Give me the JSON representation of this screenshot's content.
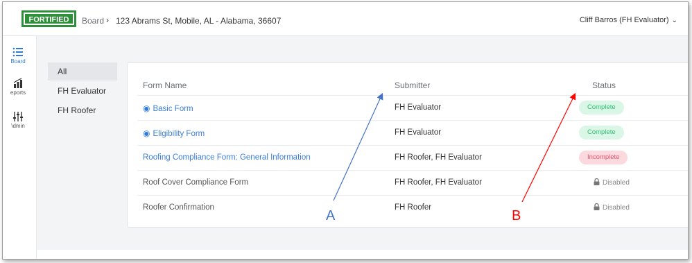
{
  "header": {
    "logo_text": "FORTIFIED",
    "breadcrumb_board": "Board",
    "breadcrumb_separator": "›",
    "breadcrumb_address": "123 Abrams St, Mobile, AL - Alabama, 36607",
    "user": "Cliff Barros (FH Evaluator)",
    "brand_green": "#2e8f3a"
  },
  "rail": {
    "items": [
      {
        "label": "Board",
        "icon": "list-icon",
        "active": true
      },
      {
        "label": "eports",
        "icon": "bar-chart-icon",
        "active": false
      },
      {
        "label": "\\dmin",
        "icon": "sliders-icon",
        "active": false
      }
    ]
  },
  "filters": [
    "All",
    "FH Evaluator",
    "FH Roofer"
  ],
  "table": {
    "headers": [
      "Form Name",
      "Submitter",
      "Status"
    ],
    "rows": [
      {
        "name": "Basic Form",
        "submitter": "FH Evaluator",
        "status": "Complete"
      },
      {
        "name": "Eligibility Form",
        "submitter": "FH Evaluator",
        "status": "Complete"
      },
      {
        "name": "Roofing Compliance Form: General Information",
        "submitter": "FH Roofer, FH Evaluator",
        "status": "Incomplete"
      },
      {
        "name": "Roof Cover Compliance Form",
        "submitter": "FH Roofer, FH Evaluator",
        "status": "Disabled"
      },
      {
        "name": "Roofer Confirmation",
        "submitter": "FH Roofer",
        "status": "Disabled"
      }
    ]
  },
  "annotations": {
    "a_label": "A",
    "b_label": "B",
    "a_color": "#4472c4",
    "b_color": "#ff0000"
  }
}
